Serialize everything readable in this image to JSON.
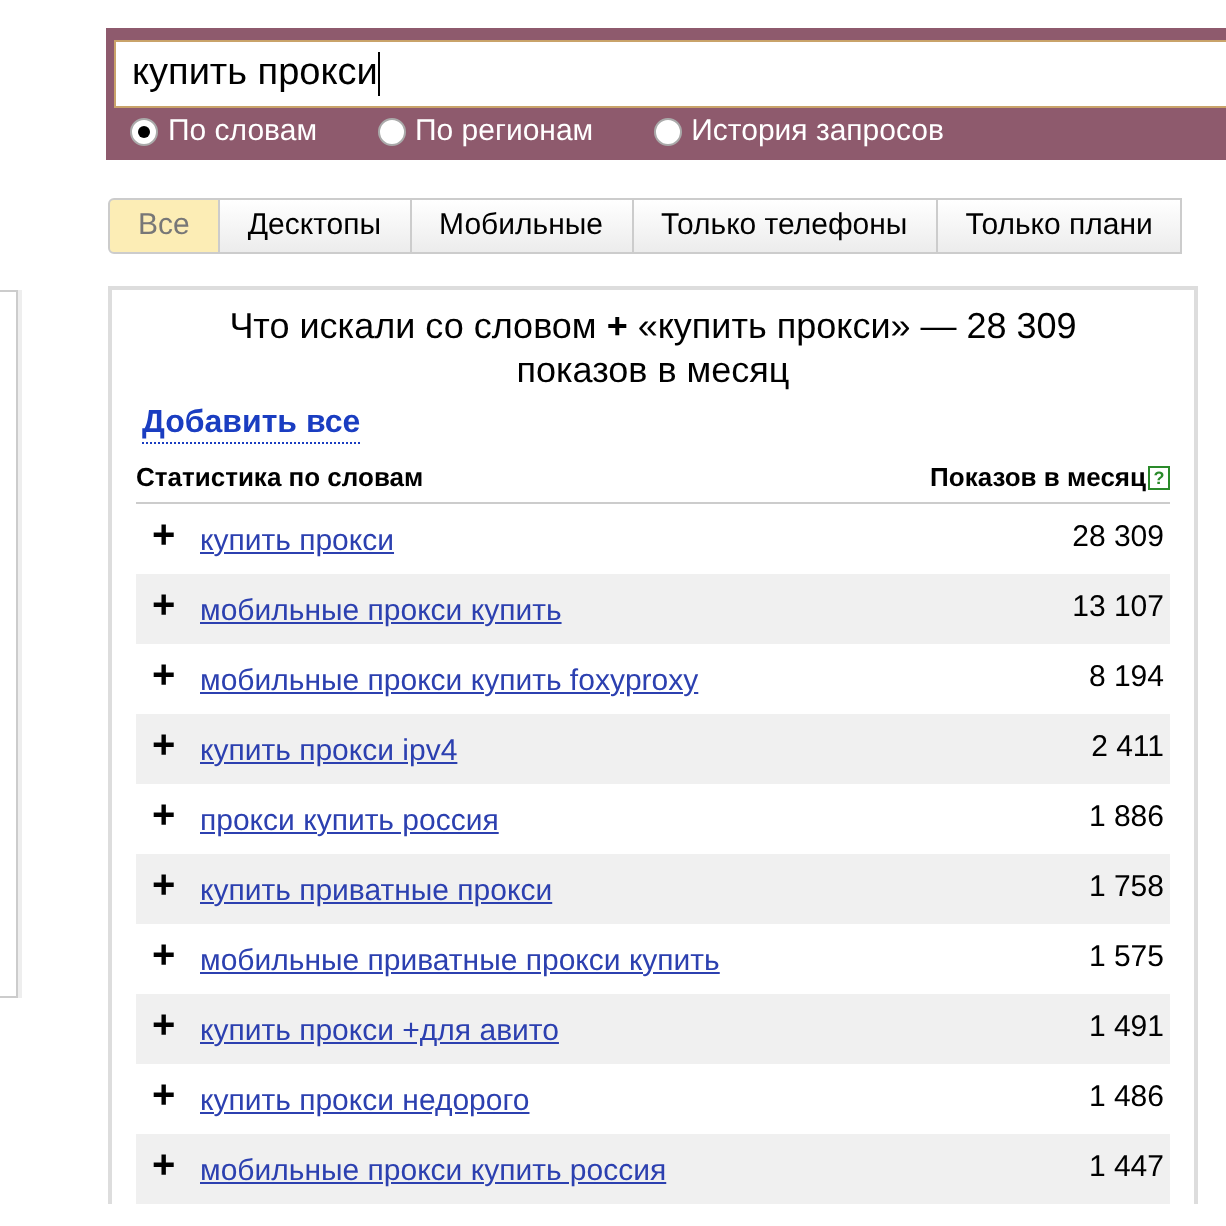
{
  "search": {
    "value": "купить прокси",
    "modes": [
      {
        "label": "По словам",
        "selected": true
      },
      {
        "label": "По регионам",
        "selected": false
      },
      {
        "label": "История запросов",
        "selected": false
      }
    ]
  },
  "tabs": [
    {
      "label": "Все",
      "selected": true
    },
    {
      "label": "Десктопы",
      "selected": false
    },
    {
      "label": "Мобильные",
      "selected": false
    },
    {
      "label": "Только телефоны",
      "selected": false
    },
    {
      "label": "Только плани",
      "selected": false
    }
  ],
  "results": {
    "title": "Что искали со словом **+** «купить прокси» — 28 309 показов в месяц",
    "add_all": "Добавить все",
    "columns": [
      "Статистика по словам",
      "Показов в месяц"
    ],
    "help": "?",
    "rows": [
      {
        "add": "+",
        "phrase": "купить прокси",
        "count": "28 309"
      },
      {
        "add": "+",
        "phrase": "мобильные прокси купить",
        "count": "13 107"
      },
      {
        "add": "+",
        "phrase": "мобильные прокси купить foxyproxy",
        "count": "8 194"
      },
      {
        "add": "+",
        "phrase": "купить прокси ipv4",
        "count": "2 411"
      },
      {
        "add": "+",
        "phrase": "прокси купить россия",
        "count": "1 886"
      },
      {
        "add": "+",
        "phrase": "купить приватные прокси",
        "count": "1 758"
      },
      {
        "add": "+",
        "phrase": "мобильные приватные прокси купить",
        "count": "1 575"
      },
      {
        "add": "+",
        "phrase": "купить прокси +для авито",
        "count": "1 491"
      },
      {
        "add": "+",
        "phrase": "купить прокси недорого",
        "count": "1 486"
      },
      {
        "add": "+",
        "phrase": "мобильные прокси купить россия",
        "count": "1 447"
      }
    ]
  }
}
